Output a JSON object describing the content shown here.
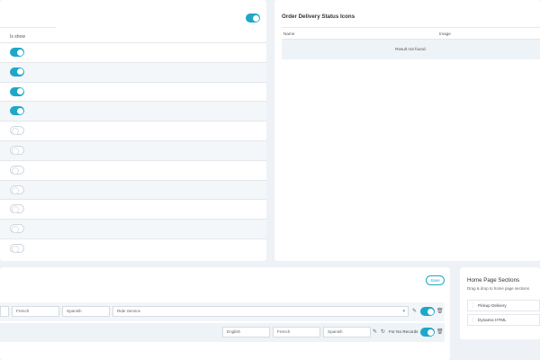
{
  "status_table": {
    "header_toggle_on": true,
    "column_header": "Is show",
    "rows": [
      {
        "on": true
      },
      {
        "on": true
      },
      {
        "on": true
      },
      {
        "on": true
      },
      {
        "on": false
      },
      {
        "on": false
      },
      {
        "on": false
      },
      {
        "on": false
      },
      {
        "on": false
      },
      {
        "on": false
      },
      {
        "on": false
      }
    ]
  },
  "order_delivery": {
    "title": "Order Delivery Status Icons",
    "col_name": "Name",
    "col_image": "Image",
    "empty_message": "Result not found."
  },
  "menu_editor": {
    "save_label": "Save",
    "row1": {
      "french_placeholder": "French",
      "spanish_placeholder": "Spanish",
      "select_value": "Ride Service"
    },
    "row2": {
      "english_placeholder": "English",
      "french_placeholder": "French",
      "spanish_placeholder": "Spanish",
      "for_no_records_label": "For No Records"
    }
  },
  "home_sections": {
    "title": "Home Page Sections",
    "subtitle": "Drag & drop to home page sections",
    "items": [
      "Pickup Delivery",
      "Dynamic HTML"
    ]
  },
  "colors": {
    "accent": "#1ea7c9",
    "page_bg": "#eef1f5",
    "row_alt": "#f4f7fa"
  }
}
